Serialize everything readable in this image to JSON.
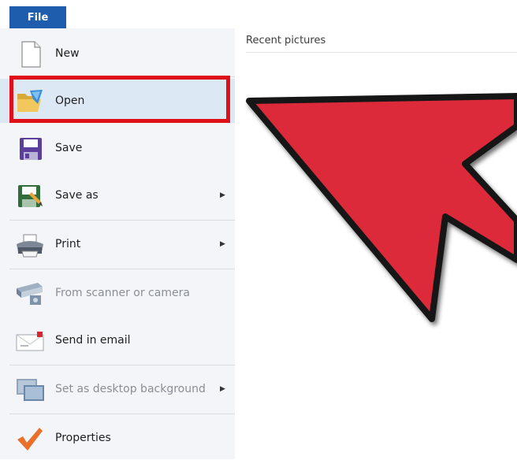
{
  "header": {
    "file_tab": "File"
  },
  "menu": {
    "items": [
      {
        "label": "New",
        "arrow": ""
      },
      {
        "label": "Open",
        "arrow": ""
      },
      {
        "label": "Save",
        "arrow": ""
      },
      {
        "label": "Save as",
        "arrow": "▶"
      },
      {
        "label": "Print",
        "arrow": "▶"
      },
      {
        "label": "From scanner or camera",
        "arrow": ""
      },
      {
        "label": "Send in email",
        "arrow": ""
      },
      {
        "label": "Set as desktop background",
        "arrow": "▶"
      },
      {
        "label": "Properties",
        "arrow": ""
      }
    ]
  },
  "recent": {
    "title": "Recent pictures"
  },
  "colors": {
    "file_tab": "#1e5cae",
    "highlight_border": "#e0101a",
    "annotation_arrow": "#dd2b3a"
  },
  "icons": {
    "new": "new-document-icon",
    "open": "open-folder-icon",
    "save": "save-disk-icon",
    "save_as": "save-as-icon",
    "print": "printer-icon",
    "scanner": "scanner-icon",
    "email": "email-icon",
    "desktop": "desktop-background-icon",
    "properties": "checkmark-properties-icon"
  }
}
